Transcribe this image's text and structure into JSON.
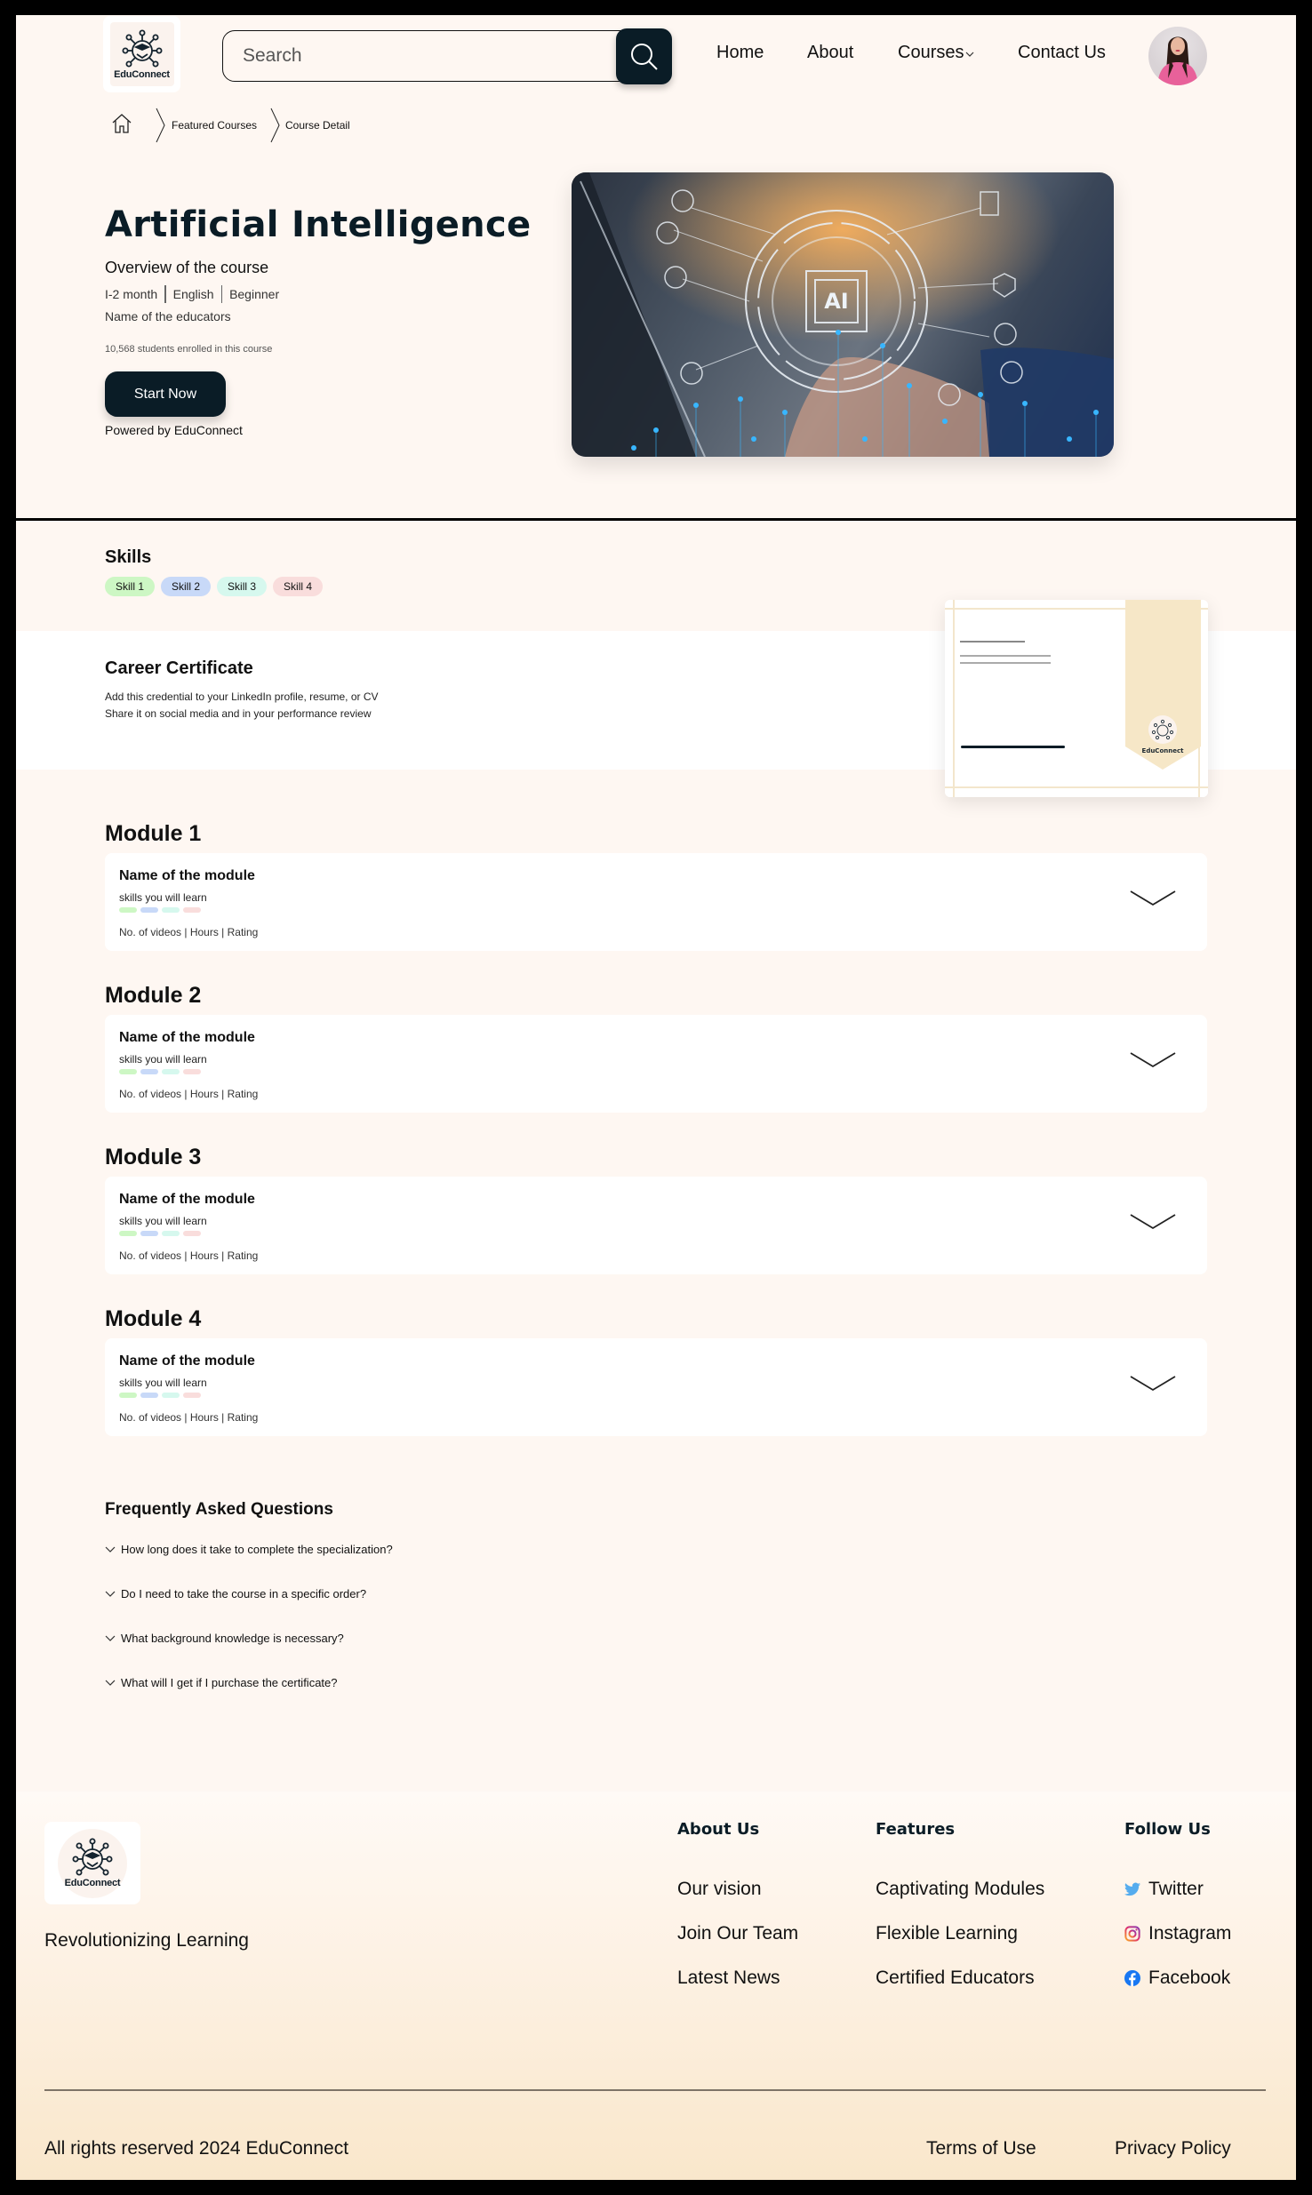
{
  "brand": {
    "name": "EduConnect"
  },
  "header": {
    "search_placeholder": "Search",
    "nav": [
      {
        "label": "Home"
      },
      {
        "label": "About"
      },
      {
        "label": "Courses",
        "has_dropdown": true
      },
      {
        "label": "Contact Us"
      }
    ],
    "avatar_alt": "User profile photo"
  },
  "breadcrumb": {
    "items": [
      {
        "label": "Featured Courses"
      },
      {
        "label": "Course Detail"
      }
    ]
  },
  "hero": {
    "title": "Artificial Intelligence",
    "overview": "Overview of the course",
    "meta": [
      "I-2 month",
      "English",
      "Beginner"
    ],
    "educators": "Name of the educators",
    "enrolled": "10,568 students enrolled in this course",
    "cta": "Start Now",
    "powered_by": "Powered by EduConnect",
    "image_label": "AI"
  },
  "skills": {
    "title": "Skills",
    "items": [
      {
        "label": "Skill 1",
        "color": "#cdf7c4"
      },
      {
        "label": "Skill 2",
        "color": "#c8d9f8"
      },
      {
        "label": "Skill 3",
        "color": "#d6f8ee"
      },
      {
        "label": "Skill 4",
        "color": "#f9dddc"
      }
    ]
  },
  "certificate": {
    "title": "Career Certificate",
    "lines": [
      "Add this credential to your LinkedIn profile, resume, or CV",
      "Share it on social media and in your performance review"
    ],
    "badge_text": "EduConnect"
  },
  "modules": [
    {
      "title": "Module 1",
      "name": "Name of the module",
      "skills_label": "skills you will learn",
      "stats": "No. of videos | Hours | Rating"
    },
    {
      "title": "Module 2",
      "name": "Name of the module",
      "skills_label": "skills you will learn",
      "stats": "No. of videos | Hours | Rating"
    },
    {
      "title": "Module 3",
      "name": "Name of the module",
      "skills_label": "skills you will learn",
      "stats": "No. of videos | Hours | Rating"
    },
    {
      "title": "Module 4",
      "name": "Name of the module",
      "skills_label": "skills you will learn",
      "stats": "No. of videos | Hours | Rating"
    }
  ],
  "faq": {
    "title": "Frequently Asked Questions",
    "items": [
      {
        "question": "How long does it take to complete the specialization?"
      },
      {
        "question": "Do I need to take the course in a specific order?"
      },
      {
        "question": "What background knowledge is necessary?"
      },
      {
        "question": "What will I get if I purchase the certificate?"
      }
    ]
  },
  "footer": {
    "tagline": "Revolutionizing Learning",
    "columns": [
      {
        "heading": "About Us",
        "links": [
          "Our vision",
          "Join Our Team",
          "Latest News"
        ]
      },
      {
        "heading": "Features",
        "links": [
          "Captivating Modules",
          "Flexible Learning",
          "Certified Educators"
        ]
      },
      {
        "heading": "Follow Us",
        "links": [
          "Twitter",
          "Instagram",
          "Facebook"
        ]
      }
    ],
    "copyright": "All rights reserved 2024 EduConnect",
    "legal": [
      "Terms of Use",
      "Privacy Policy"
    ]
  },
  "colors": {
    "primary": "#0a1c26",
    "page_bg": "#fef7f2",
    "twitter": "#55acee",
    "facebook": "#1877f2"
  }
}
